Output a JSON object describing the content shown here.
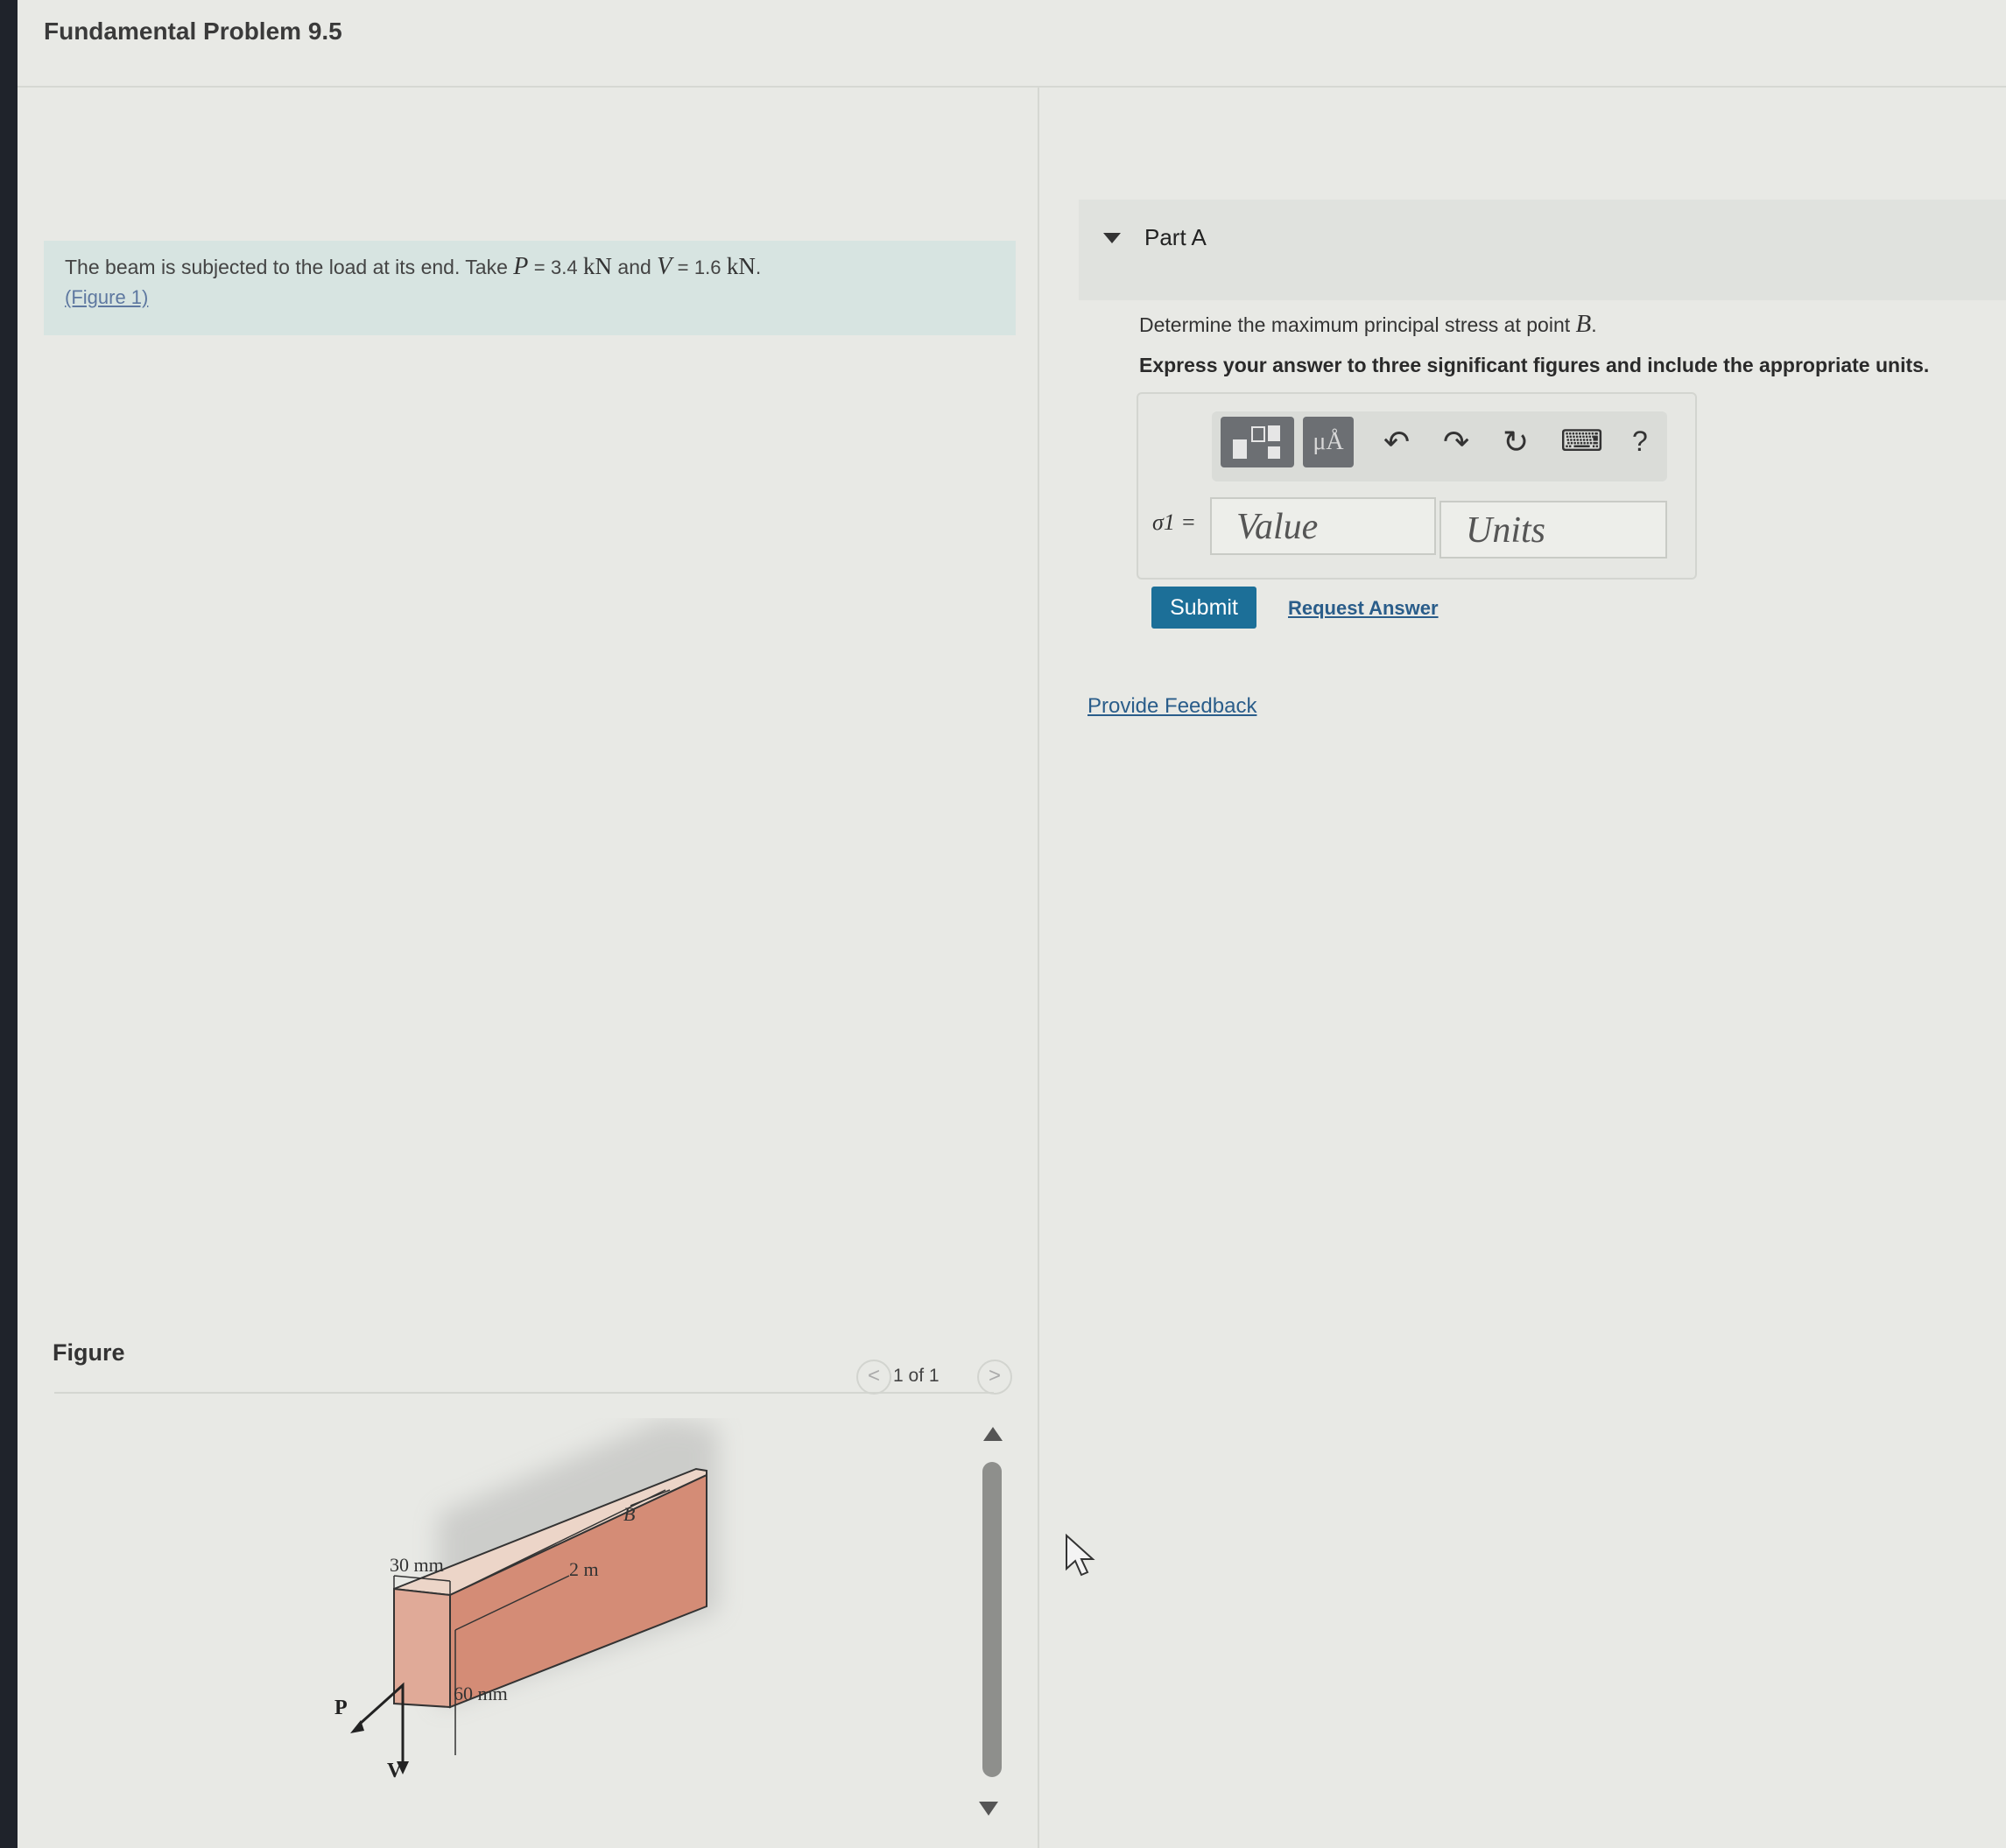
{
  "header": {
    "title": "Fundamental Problem 9.5"
  },
  "intro": {
    "text_before": "The beam is subjected to the load at its end. Take",
    "p_symbol": "P",
    "p_value": "3.4",
    "p_unit": "kN",
    "and_text": "and",
    "v_symbol": "V",
    "v_value": "1.6",
    "v_unit": "kN",
    "figure_link": "(Figure 1)"
  },
  "figure": {
    "label": "Figure",
    "pager": {
      "prev": "<",
      "count": "1 of 1",
      "next": ">"
    },
    "labels": {
      "dim_30": "30 mm",
      "dim_2m": "2 m",
      "dim_60": "60 mm",
      "point_b": "B",
      "load_p": "P",
      "load_v": "V"
    },
    "colors": {
      "beam_top": "#ecd5c8",
      "beam_front": "#e0aa98",
      "beam_side": "#d48c76"
    }
  },
  "part_a": {
    "title": "Part A",
    "question_prefix": "Determine the maximum principal stress at point",
    "question_point": "B",
    "instruction": "Express your answer to three significant figures and include the appropriate units.",
    "toolbar": {
      "units_icon_text": "μÅ",
      "undo": "↶",
      "redo": "↷",
      "reset": "↻",
      "keyboard": "⌨",
      "help": "?"
    },
    "answer_label": "σ1 =",
    "value_placeholder": "Value",
    "units_placeholder": "Units",
    "submit_label": "Submit",
    "request_label": "Request Answer"
  },
  "feedback": {
    "label": "Provide Feedback"
  },
  "colors": {
    "accent": "#1c6f98",
    "link": "#2a5d8a",
    "intro_bg": "#d7e4e1"
  }
}
